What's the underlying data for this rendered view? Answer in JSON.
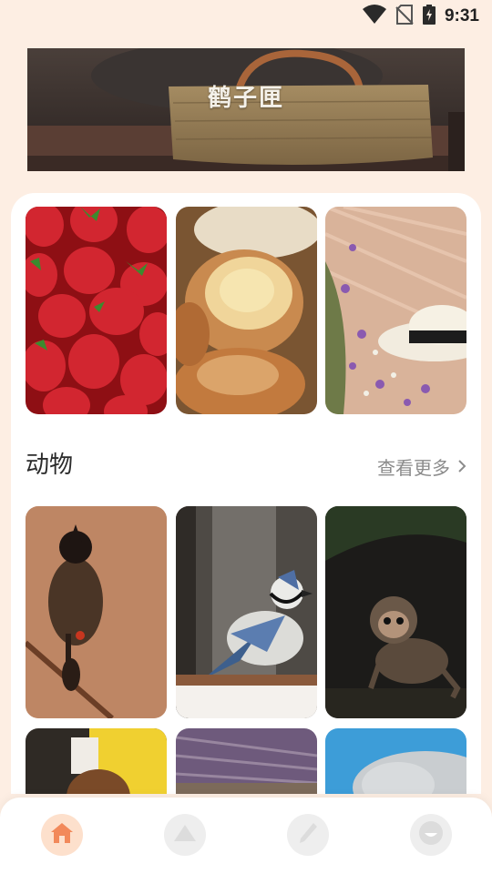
{
  "status_bar": {
    "time": "9:31",
    "icons": [
      "wifi-icon",
      "no-sim-icon",
      "battery-charging-icon"
    ]
  },
  "banner": {
    "title": "鹤子匣"
  },
  "featured": {
    "items": [
      {
        "name": "strawberries-image"
      },
      {
        "name": "bread-image"
      },
      {
        "name": "straw-hat-flowers-image"
      }
    ]
  },
  "animals": {
    "title": "动物",
    "more_label": "查看更多",
    "items": [
      {
        "name": "bird-image"
      },
      {
        "name": "blue-jay-image"
      },
      {
        "name": "monkey-image"
      },
      {
        "name": "yellow-flower-image"
      },
      {
        "name": "grass-field-image"
      },
      {
        "name": "seal-image"
      }
    ]
  },
  "bottom_nav": {
    "items": [
      {
        "icon": "home-icon",
        "active": true
      },
      {
        "icon": "mountain-icon",
        "active": false
      },
      {
        "icon": "pen-icon",
        "active": false
      },
      {
        "icon": "smiley-icon",
        "active": false
      }
    ]
  },
  "colors": {
    "background": "#fdeee3",
    "accent": "#f2895a",
    "inactive_icon": "#dcdcdc"
  }
}
